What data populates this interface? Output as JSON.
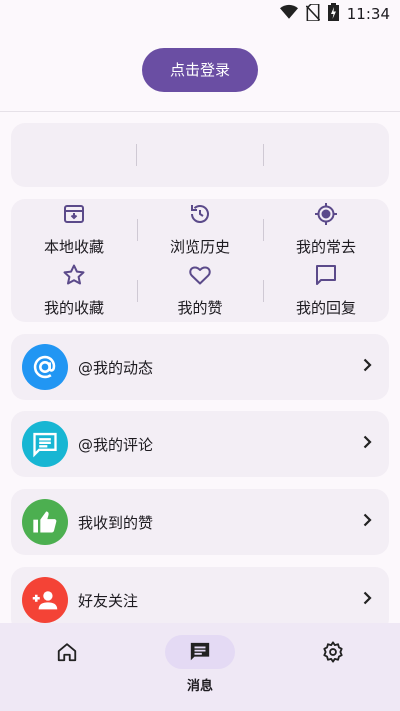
{
  "status_bar": {
    "time": "11:34",
    "icons": [
      "wifi-icon",
      "no-sim-icon",
      "battery-charging-icon"
    ]
  },
  "header": {
    "login_label": "点击登录"
  },
  "quick_grid": [
    {
      "label": "本地收藏",
      "icon": "archive-icon"
    },
    {
      "label": "浏览历史",
      "icon": "history-icon"
    },
    {
      "label": "我的常去",
      "icon": "target-icon"
    },
    {
      "label": "我的收藏",
      "icon": "star-icon"
    },
    {
      "label": "我的赞",
      "icon": "heart-icon"
    },
    {
      "label": "我的回复",
      "icon": "comment-icon"
    }
  ],
  "list": [
    {
      "label": "@我的动态",
      "icon": "at-icon",
      "color": "#2196f3"
    },
    {
      "label": "@我的评论",
      "icon": "chat-icon",
      "color": "#17b6d3"
    },
    {
      "label": "我收到的赞",
      "icon": "thumb-up-icon",
      "color": "#4caf50"
    },
    {
      "label": "好友关注",
      "icon": "person-add-icon",
      "color": "#f44336"
    }
  ],
  "bottom_nav": [
    {
      "label": "",
      "icon": "home-icon"
    },
    {
      "label": "消息",
      "icon": "message-icon",
      "active": true
    },
    {
      "label": "",
      "icon": "settings-icon"
    }
  ],
  "colors": {
    "accent": "#6a4ea3",
    "icon": "#5b4a8a",
    "background": "#fcf8fc"
  }
}
